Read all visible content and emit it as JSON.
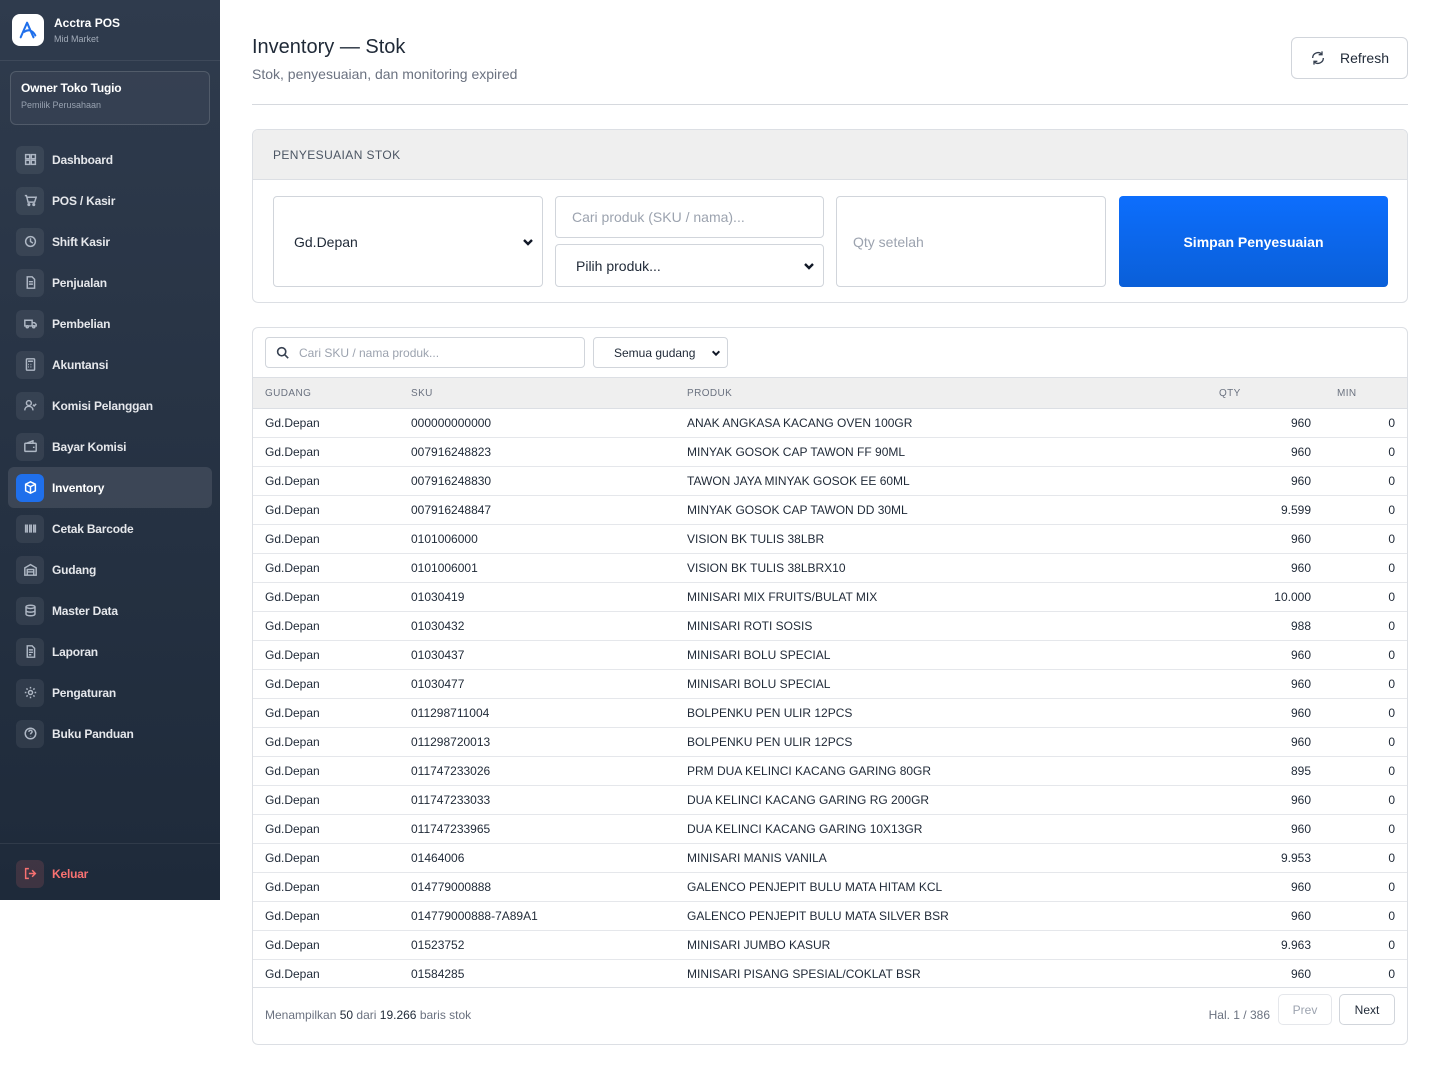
{
  "app": {
    "name": "Acctra POS",
    "tier": "Mid Market"
  },
  "user": {
    "name": "Owner Toko Tugio",
    "role": "Pemilik Perusahaan"
  },
  "sidebar": {
    "items": [
      {
        "label": "Dashboard",
        "icon": "dashboard-icon"
      },
      {
        "label": "POS / Kasir",
        "icon": "cart-icon"
      },
      {
        "label": "Shift Kasir",
        "icon": "clock-icon"
      },
      {
        "label": "Penjualan",
        "icon": "document-icon"
      },
      {
        "label": "Pembelian",
        "icon": "truck-icon"
      },
      {
        "label": "Akuntansi",
        "icon": "calculator-icon"
      },
      {
        "label": "Komisi Pelanggan",
        "icon": "user-check-icon"
      },
      {
        "label": "Bayar Komisi",
        "icon": "wallet-icon"
      },
      {
        "label": "Inventory",
        "icon": "box-icon",
        "active": true
      },
      {
        "label": "Cetak Barcode",
        "icon": "barcode-icon"
      },
      {
        "label": "Gudang",
        "icon": "warehouse-icon"
      },
      {
        "label": "Master Data",
        "icon": "database-icon"
      },
      {
        "label": "Laporan",
        "icon": "report-icon"
      },
      {
        "label": "Pengaturan",
        "icon": "gear-icon"
      },
      {
        "label": "Buku Panduan",
        "icon": "help-icon"
      }
    ],
    "logout_label": "Keluar"
  },
  "header": {
    "title": "Inventory — Stok",
    "subtitle": "Stok, penyesuaian, dan monitoring expired",
    "refresh_label": "Refresh"
  },
  "adjustment": {
    "section_title": "PENYESUAIAN STOK",
    "warehouse_value": "Gd.Depan",
    "product_search_placeholder": "Cari produk (SKU / nama)...",
    "product_select_value": "Pilih produk...",
    "qty_placeholder": "Qty setelah",
    "save_label": "Simpan Penyesuaian"
  },
  "stock_table": {
    "search_placeholder": "Cari SKU / nama produk...",
    "warehouse_filter": "Semua gudang",
    "columns": {
      "gudang": "GUDANG",
      "sku": "SKU",
      "produk": "PRODUK",
      "qty": "QTY",
      "min": "MIN"
    },
    "rows": [
      {
        "gudang": "Gd.Depan",
        "sku": "000000000000",
        "produk": "ANAK ANGKASA KACANG OVEN 100GR",
        "qty": "960",
        "min": "0"
      },
      {
        "gudang": "Gd.Depan",
        "sku": "007916248823",
        "produk": "MINYAK GOSOK CAP TAWON FF 90ML",
        "qty": "960",
        "min": "0"
      },
      {
        "gudang": "Gd.Depan",
        "sku": "007916248830",
        "produk": "TAWON JAYA MINYAK GOSOK EE 60ML",
        "qty": "960",
        "min": "0"
      },
      {
        "gudang": "Gd.Depan",
        "sku": "007916248847",
        "produk": "MINYAK GOSOK CAP TAWON DD 30ML",
        "qty": "9.599",
        "min": "0"
      },
      {
        "gudang": "Gd.Depan",
        "sku": "0101006000",
        "produk": "VISION BK TULIS 38LBR",
        "qty": "960",
        "min": "0"
      },
      {
        "gudang": "Gd.Depan",
        "sku": "0101006001",
        "produk": "VISION BK TULIS 38LBRX10",
        "qty": "960",
        "min": "0"
      },
      {
        "gudang": "Gd.Depan",
        "sku": "01030419",
        "produk": "MINISARI MIX FRUITS/BULAT MIX",
        "qty": "10.000",
        "min": "0"
      },
      {
        "gudang": "Gd.Depan",
        "sku": "01030432",
        "produk": "MINISARI ROTI SOSIS",
        "qty": "988",
        "min": "0"
      },
      {
        "gudang": "Gd.Depan",
        "sku": "01030437",
        "produk": "MINISARI BOLU SPECIAL",
        "qty": "960",
        "min": "0"
      },
      {
        "gudang": "Gd.Depan",
        "sku": "01030477",
        "produk": "MINISARI BOLU SPECIAL",
        "qty": "960",
        "min": "0"
      },
      {
        "gudang": "Gd.Depan",
        "sku": "011298711004",
        "produk": "BOLPENKU PEN ULIR 12PCS",
        "qty": "960",
        "min": "0"
      },
      {
        "gudang": "Gd.Depan",
        "sku": "011298720013",
        "produk": "BOLPENKU PEN ULIR 12PCS",
        "qty": "960",
        "min": "0"
      },
      {
        "gudang": "Gd.Depan",
        "sku": "011747233026",
        "produk": "PRM DUA KELINCI KACANG GARING 80GR",
        "qty": "895",
        "min": "0"
      },
      {
        "gudang": "Gd.Depan",
        "sku": "011747233033",
        "produk": "DUA KELINCI KACANG GARING RG 200GR",
        "qty": "960",
        "min": "0"
      },
      {
        "gudang": "Gd.Depan",
        "sku": "011747233965",
        "produk": "DUA KELINCI KACANG GARING 10X13GR",
        "qty": "960",
        "min": "0"
      },
      {
        "gudang": "Gd.Depan",
        "sku": "01464006",
        "produk": "MINISARI MANIS VANILA",
        "qty": "9.953",
        "min": "0"
      },
      {
        "gudang": "Gd.Depan",
        "sku": "014779000888",
        "produk": "GALENCO PENJEPIT BULU MATA HITAM KCL",
        "qty": "960",
        "min": "0"
      },
      {
        "gudang": "Gd.Depan",
        "sku": "014779000888-7A89A1",
        "produk": "GALENCO PENJEPIT BULU MATA SILVER BSR",
        "qty": "960",
        "min": "0"
      },
      {
        "gudang": "Gd.Depan",
        "sku": "01523752",
        "produk": "MINISARI JUMBO KASUR",
        "qty": "9.963",
        "min": "0"
      },
      {
        "gudang": "Gd.Depan",
        "sku": "01584285",
        "produk": "MINISARI PISANG SPESIAL/COKLAT BSR",
        "qty": "960",
        "min": "0"
      }
    ],
    "footer": {
      "prefix": "Menampilkan",
      "shown": "50",
      "middle": "dari",
      "total": "19.266",
      "suffix": "baris stok",
      "page_label": "Hal. 1 / 386",
      "prev_label": "Prev",
      "next_label": "Next"
    }
  },
  "colors": {
    "accent": "#0d6efd",
    "sidebar": "#2a3648",
    "logout": "#f87171"
  }
}
